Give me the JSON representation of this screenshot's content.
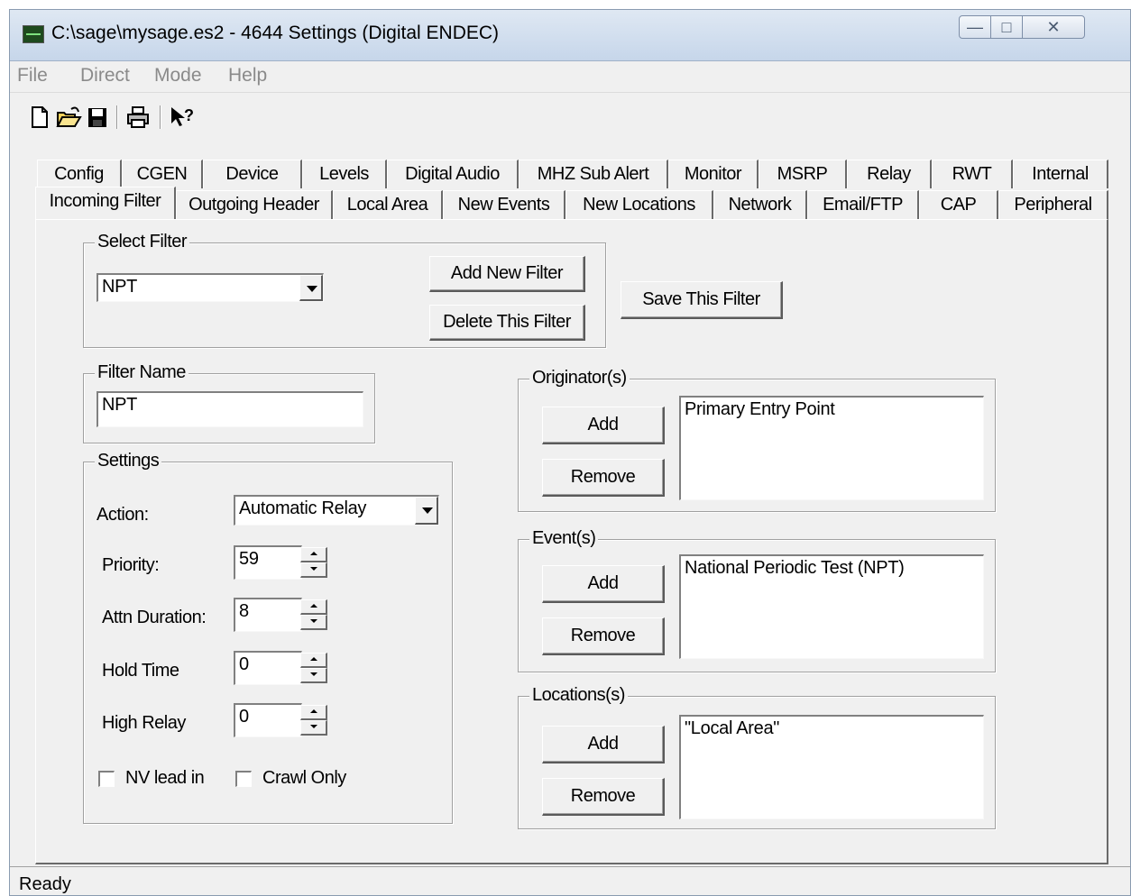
{
  "window": {
    "title": "C:\\sage\\mysage.es2 - 4644 Settings (Digital ENDEC)"
  },
  "menu": [
    "File",
    "Direct",
    "Mode",
    "Help"
  ],
  "toolbar": {
    "icons": [
      "new-icon",
      "open-icon",
      "save-icon",
      "print-icon",
      "help-pointer-icon"
    ]
  },
  "tabs": {
    "row1": [
      "Config",
      "CGEN",
      "Device",
      "Levels",
      "Digital Audio",
      "MHZ Sub Alert",
      "Monitor",
      "MSRP",
      "Relay",
      "RWT",
      "Internal"
    ],
    "row2": [
      "Incoming Filter",
      "Outgoing Header",
      "Local Area",
      "New Events",
      "New Locations",
      "Network",
      "Email/FTP",
      "CAP",
      "Peripheral"
    ],
    "active": "Incoming Filter"
  },
  "select_filter": {
    "title": "Select Filter",
    "value": "NPT",
    "add_label": "Add New Filter",
    "delete_label": "Delete This Filter",
    "save_label": "Save This Filter"
  },
  "filter_name": {
    "title": "Filter Name",
    "value": "NPT"
  },
  "settings": {
    "title": "Settings",
    "action_label": "Action:",
    "action_value": "Automatic Relay",
    "priority_label": "Priority:",
    "priority_value": "59",
    "attn_label": "Attn Duration:",
    "attn_value": "8",
    "hold_label": "Hold Time",
    "hold_value": "0",
    "high_relay_label": "High Relay",
    "high_relay_value": "0",
    "nv_lead_label": "NV lead in",
    "nv_lead_checked": false,
    "crawl_label": "Crawl Only",
    "crawl_checked": false
  },
  "originators": {
    "title": "Originator(s)",
    "add": "Add",
    "remove": "Remove",
    "items": [
      "Primary Entry Point"
    ]
  },
  "events": {
    "title": "Event(s)",
    "add": "Add",
    "remove": "Remove",
    "items": [
      "National Periodic Test (NPT)"
    ]
  },
  "locations": {
    "title": "Locations(s)",
    "add": "Add",
    "remove": "Remove",
    "items": [
      "\"Local Area\""
    ]
  },
  "status": "Ready"
}
